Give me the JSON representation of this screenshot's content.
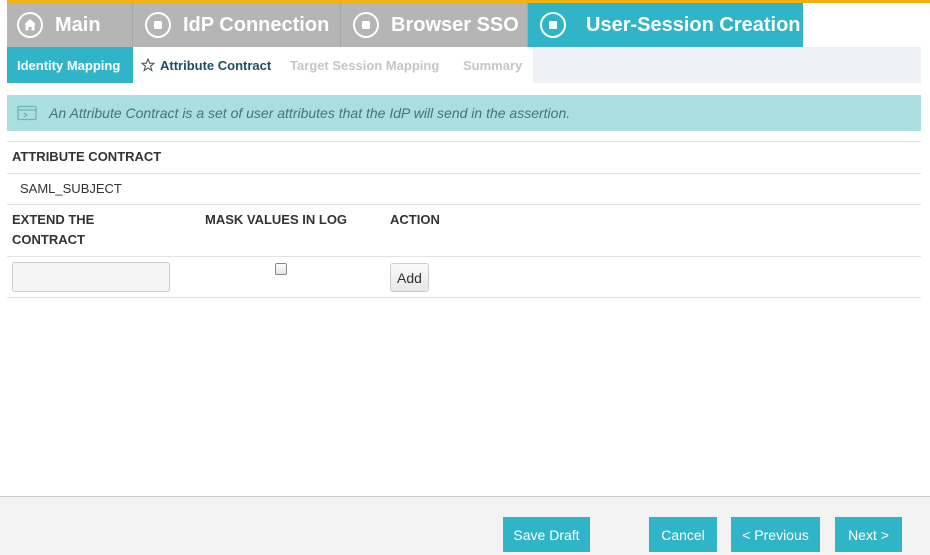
{
  "wizard_tabs": [
    {
      "label": "Main",
      "icon": "home-icon",
      "state": "inactive"
    },
    {
      "label": "IdP Connection",
      "icon": "stop-circle-icon",
      "state": "inactive"
    },
    {
      "label": "Browser SSO",
      "icon": "stop-circle-icon",
      "state": "inactive"
    },
    {
      "label": "User-Session Creation",
      "icon": "stop-circle-icon",
      "state": "active"
    }
  ],
  "sub_tabs": [
    {
      "label": "Identity Mapping",
      "state": "completed"
    },
    {
      "label": "Attribute Contract",
      "state": "current",
      "icon": "star-icon"
    },
    {
      "label": "Target Session Mapping",
      "state": "disabled"
    },
    {
      "label": "Summary",
      "state": "disabled"
    }
  ],
  "info_banner": {
    "icon": "info-icon",
    "text": "An Attribute Contract is a set of user attributes that the IdP will send in the assertion."
  },
  "attribute_contract": {
    "header": "ATTRIBUTE CONTRACT",
    "items": [
      "SAML_SUBJECT"
    ]
  },
  "extend_table": {
    "columns": [
      "EXTEND THE CONTRACT",
      "MASK VALUES IN LOG",
      "ACTION"
    ],
    "new_row": {
      "attribute_value": "",
      "mask_checked": false,
      "action_label": "Add"
    }
  },
  "footer": {
    "save_draft": "Save Draft",
    "cancel": "Cancel",
    "previous": "< Previous",
    "next": "Next >"
  },
  "colors": {
    "accent": "#2fb5c7",
    "top_border": "#f2b10f",
    "inactive_tab": "#b5b5b5",
    "info_bg": "#abdfdf"
  }
}
